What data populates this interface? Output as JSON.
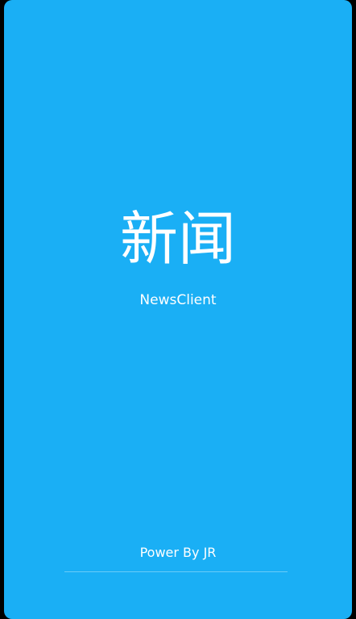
{
  "splash": {
    "title": "新闻",
    "subtitle": "NewsClient",
    "footer": "Power By JR"
  },
  "colors": {
    "background": "#1AAFF5",
    "text": "#FFFFFF",
    "frame": "#000000"
  }
}
